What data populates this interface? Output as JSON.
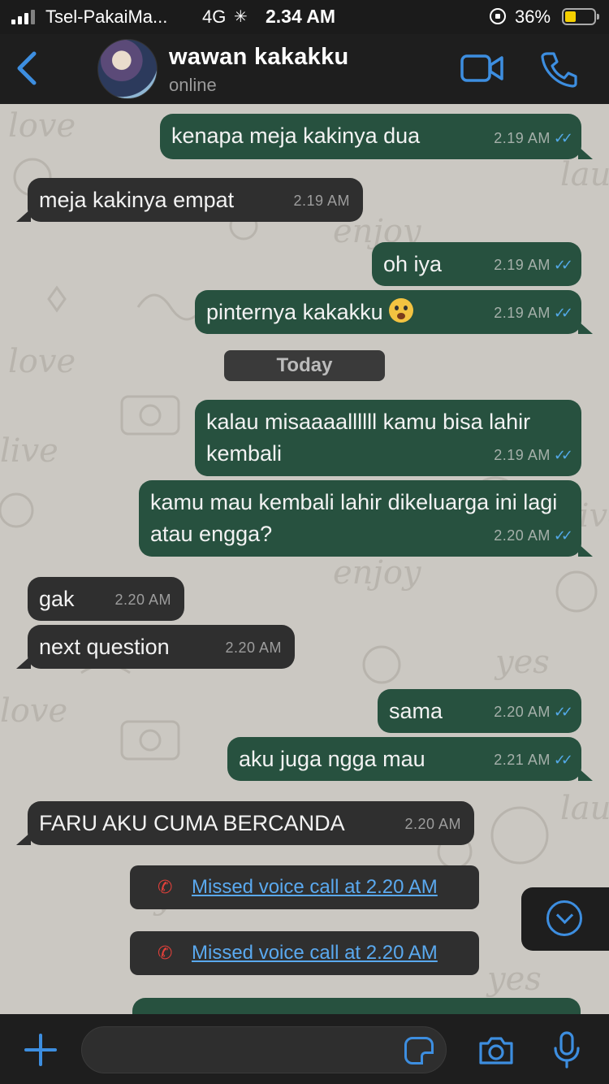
{
  "status_bar": {
    "carrier": "Tsel-PakaiMa...",
    "network": "4G",
    "time": "2.34 AM",
    "battery_percent": "36%",
    "battery_level": 0.36
  },
  "header": {
    "contact_name": "wawan kakakku",
    "presence": "online"
  },
  "messages": [
    {
      "dir": "out",
      "text": "kenapa meja kakinya dua",
      "time": "2.19 AM",
      "ticks": "✓✓"
    },
    {
      "dir": "in",
      "text": "meja kakinya empat",
      "time": "2.19 AM"
    },
    {
      "dir": "out",
      "text": "oh iya",
      "time": "2.19 AM",
      "ticks": "✓✓"
    },
    {
      "dir": "out",
      "text": "pinternya kakakku",
      "emoji": "screaming-cat-emoji",
      "time": "2.19 AM",
      "ticks": "✓✓"
    },
    {
      "dir": "out",
      "text": "kalau misaaaallllll kamu bisa lahir kembali",
      "time": "2.19 AM",
      "ticks": "✓✓"
    },
    {
      "dir": "out",
      "text": "kamu mau kembali lahir dikeluarga ini lagi atau engga?",
      "time": "2.20 AM",
      "ticks": "✓✓"
    },
    {
      "dir": "in",
      "text": "gak",
      "time": "2.20 AM"
    },
    {
      "dir": "in",
      "text": "next question",
      "time": "2.20 AM"
    },
    {
      "dir": "out",
      "text": "sama",
      "time": "2.20 AM",
      "ticks": "✓✓"
    },
    {
      "dir": "out",
      "text": "aku juga ngga mau",
      "time": "2.21 AM",
      "ticks": "✓✓"
    },
    {
      "dir": "in",
      "text": "FARU AKU CUMA BERCANDA",
      "time": "2.20 AM"
    }
  ],
  "day_divider": "Today",
  "call_notes": [
    {
      "text": "Missed voice call at 2.20 AM",
      "icon": "missed-call-icon"
    },
    {
      "text": "Missed voice call at 2.20 AM",
      "icon": "missed-call-icon"
    }
  ],
  "input": {
    "value": "",
    "placeholder": ""
  },
  "colors": {
    "outgoing_bubble": "#27513f",
    "incoming_bubble": "#2f2f2f",
    "accent": "#3d8ee0",
    "read_ticks": "#53a9e8",
    "missed_call": "#e0403a"
  }
}
